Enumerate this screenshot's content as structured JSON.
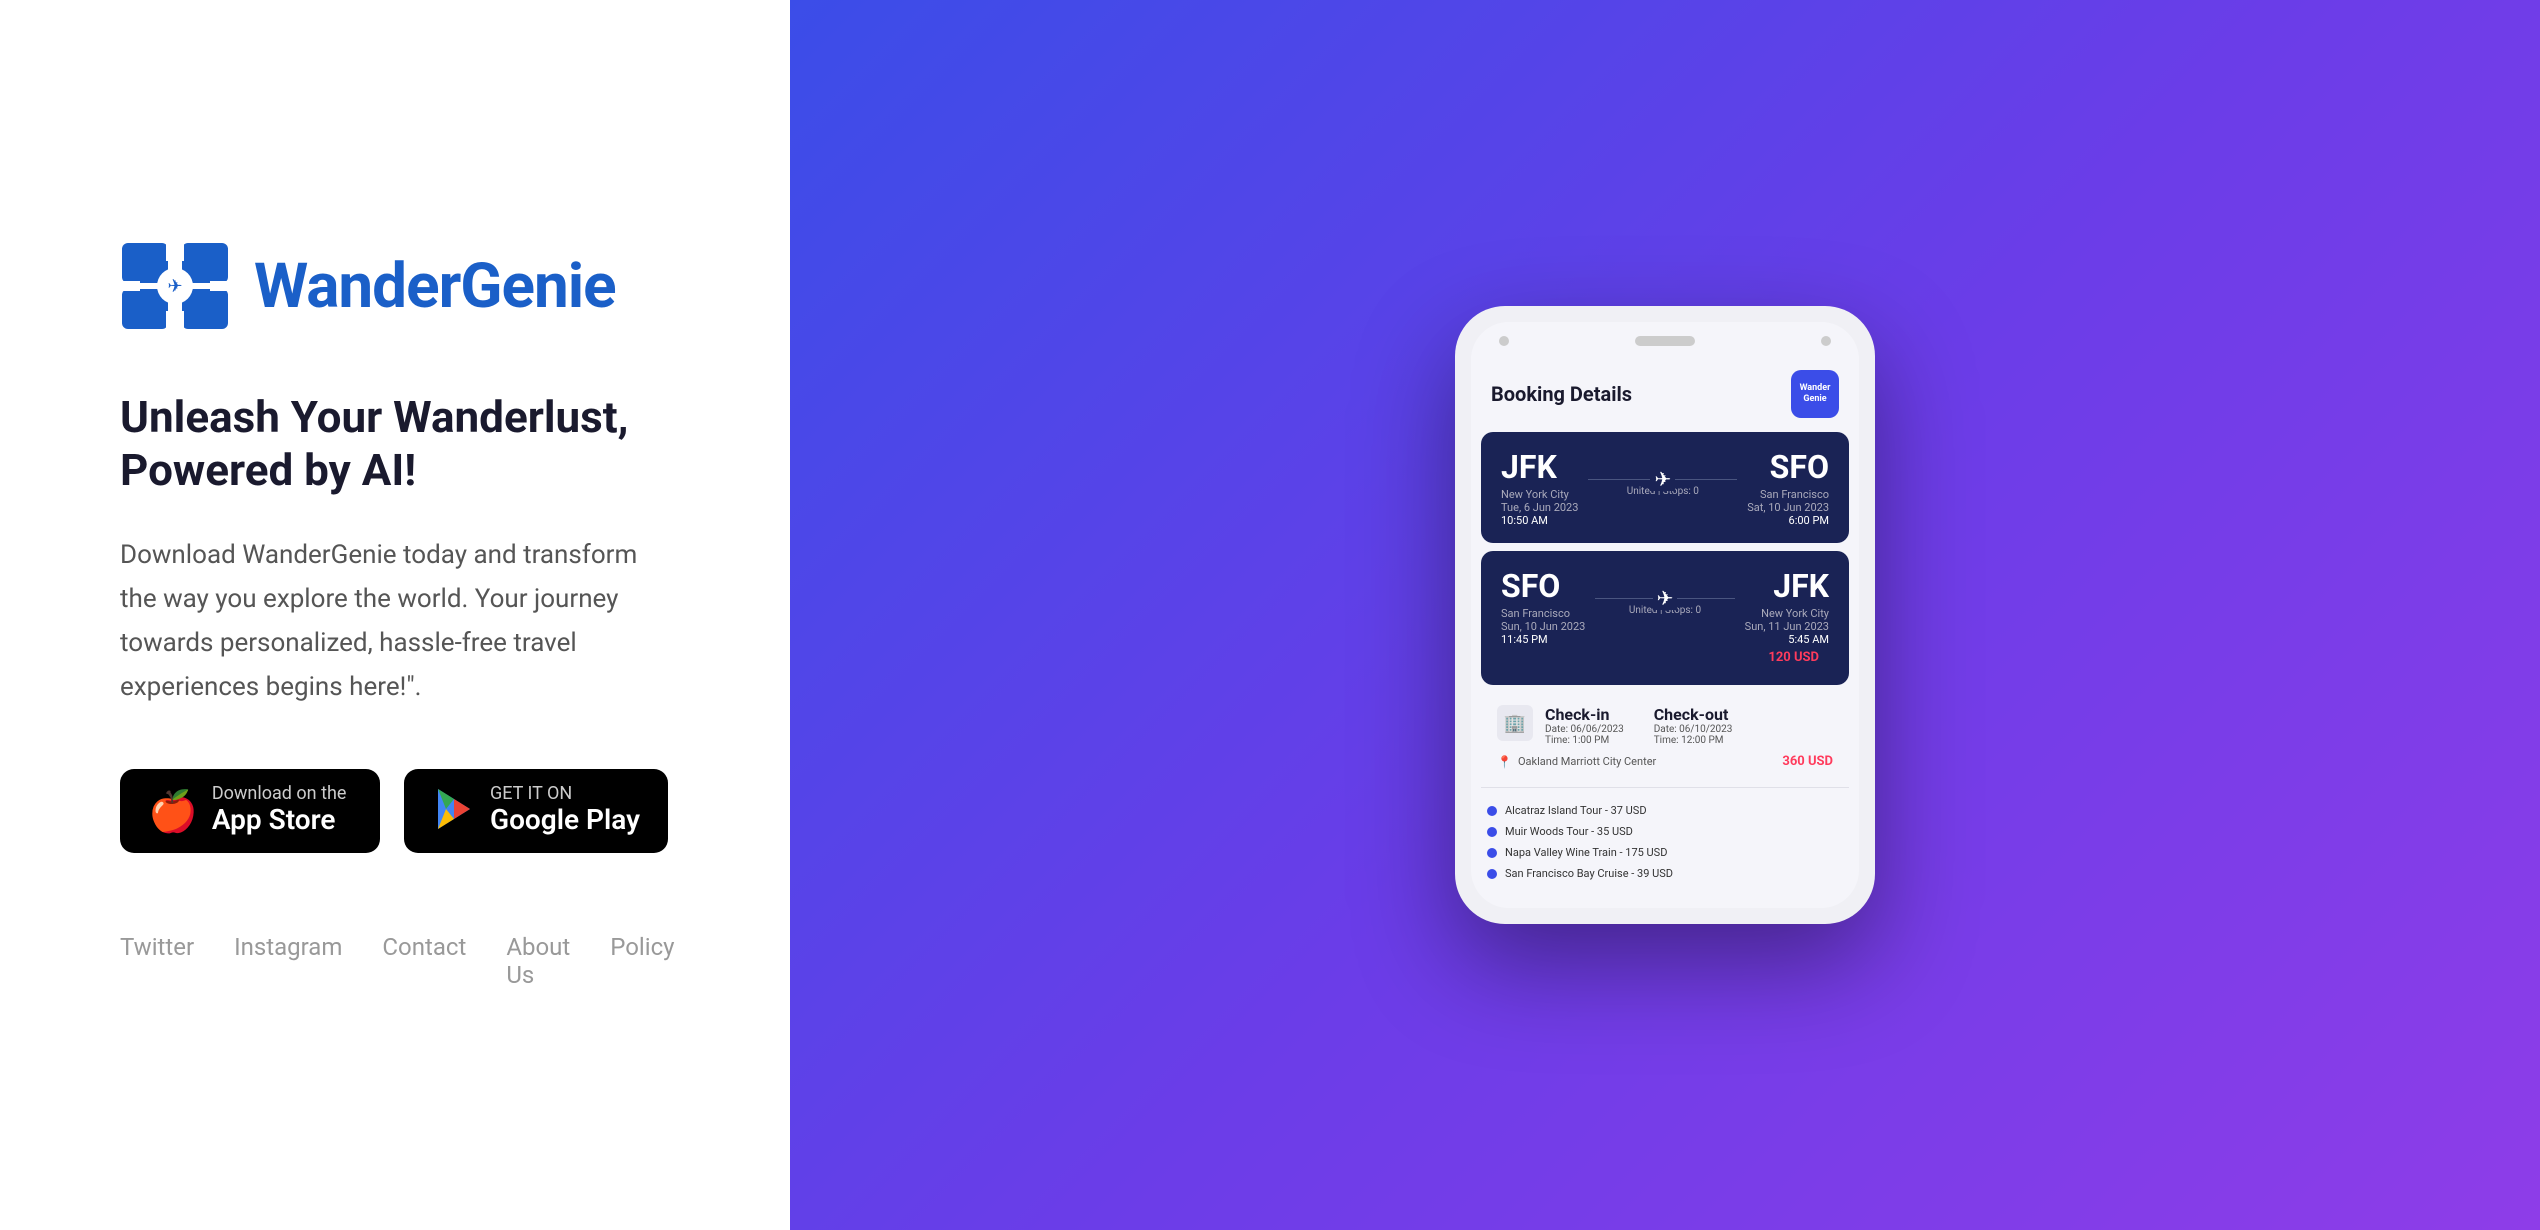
{
  "left": {
    "logo_text": "WanderGenie",
    "headline": "Unleash Your Wanderlust, Powered by AI!",
    "description": "Download WanderGenie today and transform the way you explore the world. Your journey towards personalized, hassle-free travel experiences begins here!\".",
    "app_store": {
      "small_text": "Download on the",
      "large_text": "App Store"
    },
    "google_play": {
      "small_text": "GET IT ON",
      "large_text": "Google Play"
    },
    "footer_links": [
      "Twitter",
      "Instagram",
      "Contact",
      "About Us",
      "Policy"
    ]
  },
  "right": {
    "app": {
      "booking_title": "Booking Details",
      "app_logo_label": "Wander\nGenie",
      "flight1": {
        "from_code": "JFK",
        "from_city": "New York City",
        "from_date": "Tue, 6 Jun 2023",
        "from_time": "10:50 AM",
        "to_code": "SFO",
        "to_city": "San Francisco",
        "to_date": "Sat, 10 Jun 2023",
        "to_time": "6:00 PM",
        "carrier": "United | Stops: 0"
      },
      "flight2": {
        "from_code": "SFO",
        "from_city": "San Francisco",
        "from_date": "Sun, 10 Jun 2023",
        "from_time": "11:45 PM",
        "to_code": "JFK",
        "to_city": "New York City",
        "to_date": "Sun, 11 Jun 2023",
        "to_time": "5:45 AM",
        "carrier": "United | Stops: 0",
        "price": "120 USD"
      },
      "hotel": {
        "checkin_title": "Check-in",
        "checkin_date": "Date:  06/06/2023",
        "checkin_time": "Time:  1:00 PM",
        "checkout_title": "Check-out",
        "checkout_date": "Date:  06/10/2023",
        "checkout_time": "Time:  12:00 PM",
        "location": "Oakland Marriott City Center",
        "price": "360 USD"
      },
      "activities": [
        "Alcatraz Island Tour - 37 USD",
        "Muir Woods Tour - 35 USD",
        "Napa Valley Wine Train - 175 USD",
        "San Francisco Bay Cruise - 39 USD"
      ]
    }
  }
}
